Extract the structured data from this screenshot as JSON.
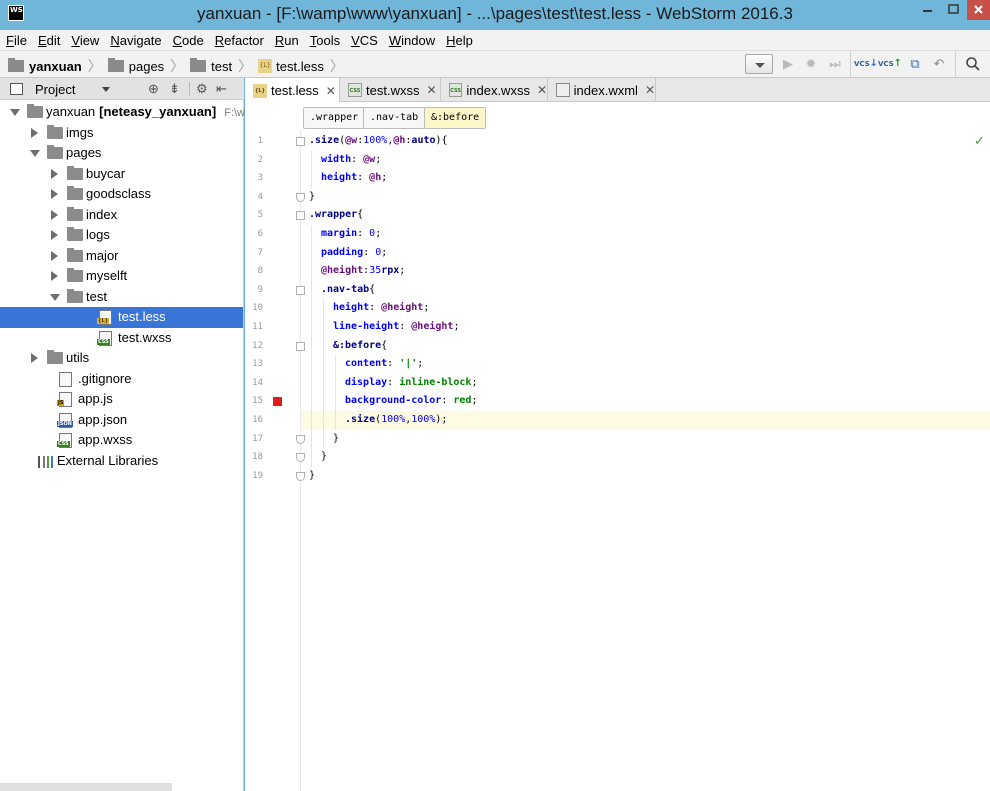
{
  "window": {
    "title": "yanxuan - [F:\\wamp\\www\\yanxuan] - ...\\pages\\test\\test.less - WebStorm 2016.3",
    "app_icon_text": "WS"
  },
  "menu": [
    "File",
    "Edit",
    "View",
    "Navigate",
    "Code",
    "Refactor",
    "Run",
    "Tools",
    "VCS",
    "Window",
    "Help"
  ],
  "navbar": {
    "crumbs": [
      "yanxuan",
      "pages",
      "test",
      "test.less"
    ]
  },
  "project_panel": {
    "title": "Project",
    "tree": [
      {
        "label": "yanxuan",
        "bold_suffix": "[neteasy_yanxuan]",
        "muted_suffix": "F:\\wa",
        "kind": "folder",
        "expanded": true,
        "depth": 0
      },
      {
        "label": "imgs",
        "kind": "folder",
        "expanded": false,
        "depth": 1
      },
      {
        "label": "pages",
        "kind": "folder",
        "expanded": true,
        "depth": 1
      },
      {
        "label": "buycar",
        "kind": "folder",
        "expanded": false,
        "depth": 2
      },
      {
        "label": "goodsclass",
        "kind": "folder",
        "expanded": false,
        "depth": 2
      },
      {
        "label": "index",
        "kind": "folder",
        "expanded": false,
        "depth": 2
      },
      {
        "label": "logs",
        "kind": "folder",
        "expanded": false,
        "depth": 2
      },
      {
        "label": "major",
        "kind": "folder",
        "expanded": false,
        "depth": 2
      },
      {
        "label": "myselft",
        "kind": "folder",
        "expanded": false,
        "depth": 2
      },
      {
        "label": "test",
        "kind": "folder",
        "expanded": true,
        "depth": 2
      },
      {
        "label": "test.less",
        "kind": "less",
        "depth": 3,
        "selected": true
      },
      {
        "label": "test.wxss",
        "kind": "css",
        "depth": 3
      },
      {
        "label": "utils",
        "kind": "folder",
        "expanded": false,
        "depth": 1
      },
      {
        "label": ".gitignore",
        "kind": "git",
        "depth": 1
      },
      {
        "label": "app.js",
        "kind": "js",
        "depth": 1
      },
      {
        "label": "app.json",
        "kind": "json",
        "depth": 1
      },
      {
        "label": "app.wxss",
        "kind": "css",
        "depth": 1
      },
      {
        "label": "External Libraries",
        "kind": "lib",
        "depth": 0
      }
    ]
  },
  "tabs": [
    {
      "label": "test.less",
      "kind": "less",
      "active": true
    },
    {
      "label": "test.wxss",
      "kind": "css",
      "active": false
    },
    {
      "label": "index.wxss",
      "kind": "css",
      "active": false
    },
    {
      "label": "index.wxml",
      "kind": "xml",
      "active": false
    }
  ],
  "code_breadcrumbs": [
    ".wrapper",
    ".nav-tab",
    "&:before"
  ],
  "code_lines": [
    {
      "n": "1",
      "indent": 0,
      "tokens": [
        [
          ".size",
          "sel-kw"
        ],
        [
          "(",
          "punc"
        ],
        [
          "@w",
          "var"
        ],
        [
          ":",
          "punc"
        ],
        [
          "100%",
          "num"
        ],
        [
          ",",
          "punc"
        ],
        [
          "@h",
          "var"
        ],
        [
          ":",
          "punc"
        ],
        [
          "auto",
          "val"
        ],
        [
          "){",
          "punc"
        ]
      ]
    },
    {
      "n": "2",
      "indent": 1,
      "tokens": [
        [
          "width",
          "prop"
        ],
        [
          ": ",
          "punc"
        ],
        [
          "@w",
          "var"
        ],
        [
          ";",
          "punc"
        ]
      ]
    },
    {
      "n": "3",
      "indent": 1,
      "tokens": [
        [
          "height",
          "prop"
        ],
        [
          ": ",
          "punc"
        ],
        [
          "@h",
          "var"
        ],
        [
          ";",
          "punc"
        ]
      ]
    },
    {
      "n": "4",
      "indent": 0,
      "tokens": [
        [
          "}",
          "punc"
        ]
      ]
    },
    {
      "n": "5",
      "indent": 0,
      "tokens": [
        [
          ".wrapper",
          "sel-kw"
        ],
        [
          "{",
          "punc"
        ]
      ]
    },
    {
      "n": "6",
      "indent": 1,
      "tokens": [
        [
          "margin",
          "prop"
        ],
        [
          ": ",
          "punc"
        ],
        [
          "0",
          "num"
        ],
        [
          ";",
          "punc"
        ]
      ]
    },
    {
      "n": "7",
      "indent": 1,
      "tokens": [
        [
          "padding",
          "prop"
        ],
        [
          ": ",
          "punc"
        ],
        [
          "0",
          "num"
        ],
        [
          ";",
          "punc"
        ]
      ]
    },
    {
      "n": "8",
      "indent": 1,
      "tokens": [
        [
          "@height",
          "var"
        ],
        [
          ":",
          "punc"
        ],
        [
          "35",
          "num"
        ],
        [
          "rpx",
          "val"
        ],
        [
          ";",
          "punc"
        ]
      ]
    },
    {
      "n": "9",
      "indent": 1,
      "tokens": [
        [
          ".nav-tab",
          "sel-kw"
        ],
        [
          "{",
          "punc"
        ]
      ]
    },
    {
      "n": "10",
      "indent": 2,
      "tokens": [
        [
          "height",
          "prop"
        ],
        [
          ": ",
          "punc"
        ],
        [
          "@height",
          "var"
        ],
        [
          ";",
          "punc"
        ]
      ]
    },
    {
      "n": "11",
      "indent": 2,
      "tokens": [
        [
          "line-height",
          "prop"
        ],
        [
          ": ",
          "punc"
        ],
        [
          "@height",
          "var"
        ],
        [
          ";",
          "punc"
        ]
      ]
    },
    {
      "n": "12",
      "indent": 2,
      "tokens": [
        [
          "&:before",
          "sel-kw"
        ],
        [
          "{",
          "punc"
        ]
      ]
    },
    {
      "n": "13",
      "indent": 3,
      "tokens": [
        [
          "content",
          "prop"
        ],
        [
          ": ",
          "punc"
        ],
        [
          "'|'",
          "str"
        ],
        [
          ";",
          "punc"
        ]
      ]
    },
    {
      "n": "14",
      "indent": 3,
      "tokens": [
        [
          "display",
          "prop"
        ],
        [
          ": ",
          "punc"
        ],
        [
          "inline-block",
          "str"
        ],
        [
          ";",
          "punc"
        ]
      ]
    },
    {
      "n": "15",
      "indent": 3,
      "tokens": [
        [
          "background-color",
          "prop"
        ],
        [
          ": ",
          "punc"
        ],
        [
          "red",
          "str"
        ],
        [
          ";",
          "punc"
        ]
      ]
    },
    {
      "n": "16",
      "indent": 3,
      "tokens": [
        [
          ".size",
          "sel-kw"
        ],
        [
          "(",
          "punc"
        ],
        [
          "100%",
          "num"
        ],
        [
          ",",
          "punc"
        ],
        [
          "100%",
          "num"
        ],
        [
          ");",
          "punc"
        ]
      ]
    },
    {
      "n": "17",
      "indent": 2,
      "tokens": [
        [
          "}",
          "punc"
        ]
      ]
    },
    {
      "n": "18",
      "indent": 1,
      "tokens": [
        [
          "}",
          "punc"
        ]
      ]
    },
    {
      "n": "19",
      "indent": 0,
      "tokens": [
        [
          "}",
          "punc"
        ]
      ]
    }
  ],
  "editor": {
    "current_line": 16,
    "breakpoint_line": 15,
    "inspection": "ok"
  },
  "colors": {
    "titlebar": "#6fb6d9",
    "selection": "#3875d7",
    "breakpoint": "#e01b1b"
  }
}
